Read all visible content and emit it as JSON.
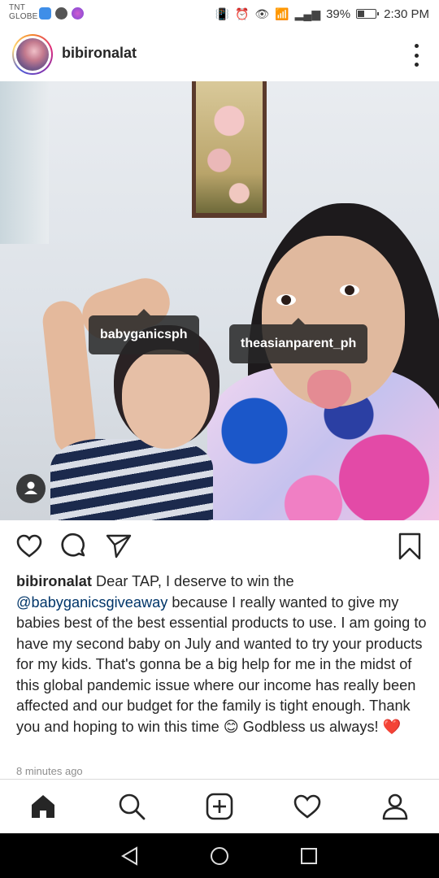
{
  "status_bar": {
    "carrier_line1": "TNT",
    "carrier_line2": "GLOBE",
    "battery_percent": "39%",
    "battery_level": 0.39,
    "time": "2:30 PM"
  },
  "post": {
    "username": "bibironalat",
    "tags": [
      {
        "label": "babyganicsph"
      },
      {
        "label": "theasianparent_ph"
      }
    ],
    "caption": {
      "username": "bibironalat",
      "text_before_mention": " Dear TAP, I deserve to win the ",
      "mention": "@babyganicsgiveaway",
      "text_after_mention": " because I really wanted to give my babies best of the best essential products to use. I am going to have my second baby on July and wanted to try your products for my kids. That's gonna be a big help for me in the midst of this global pandemic issue where our income has really been affected and our budget for the family is tight enough. Thank you and hoping to win this time ",
      "emoji_smile": "😊",
      "text_end": " Godbless us always! ",
      "emoji_heart": "❤️"
    },
    "timestamp": "8 minutes ago"
  },
  "icons": {
    "actions": [
      "heart-icon",
      "comment-icon",
      "share-icon",
      "bookmark-icon"
    ],
    "bottom_nav": [
      "home-icon",
      "search-icon",
      "add-post-icon",
      "activity-icon",
      "profile-icon"
    ],
    "system_nav": [
      "back-icon",
      "home-circle-icon",
      "recents-icon"
    ]
  }
}
